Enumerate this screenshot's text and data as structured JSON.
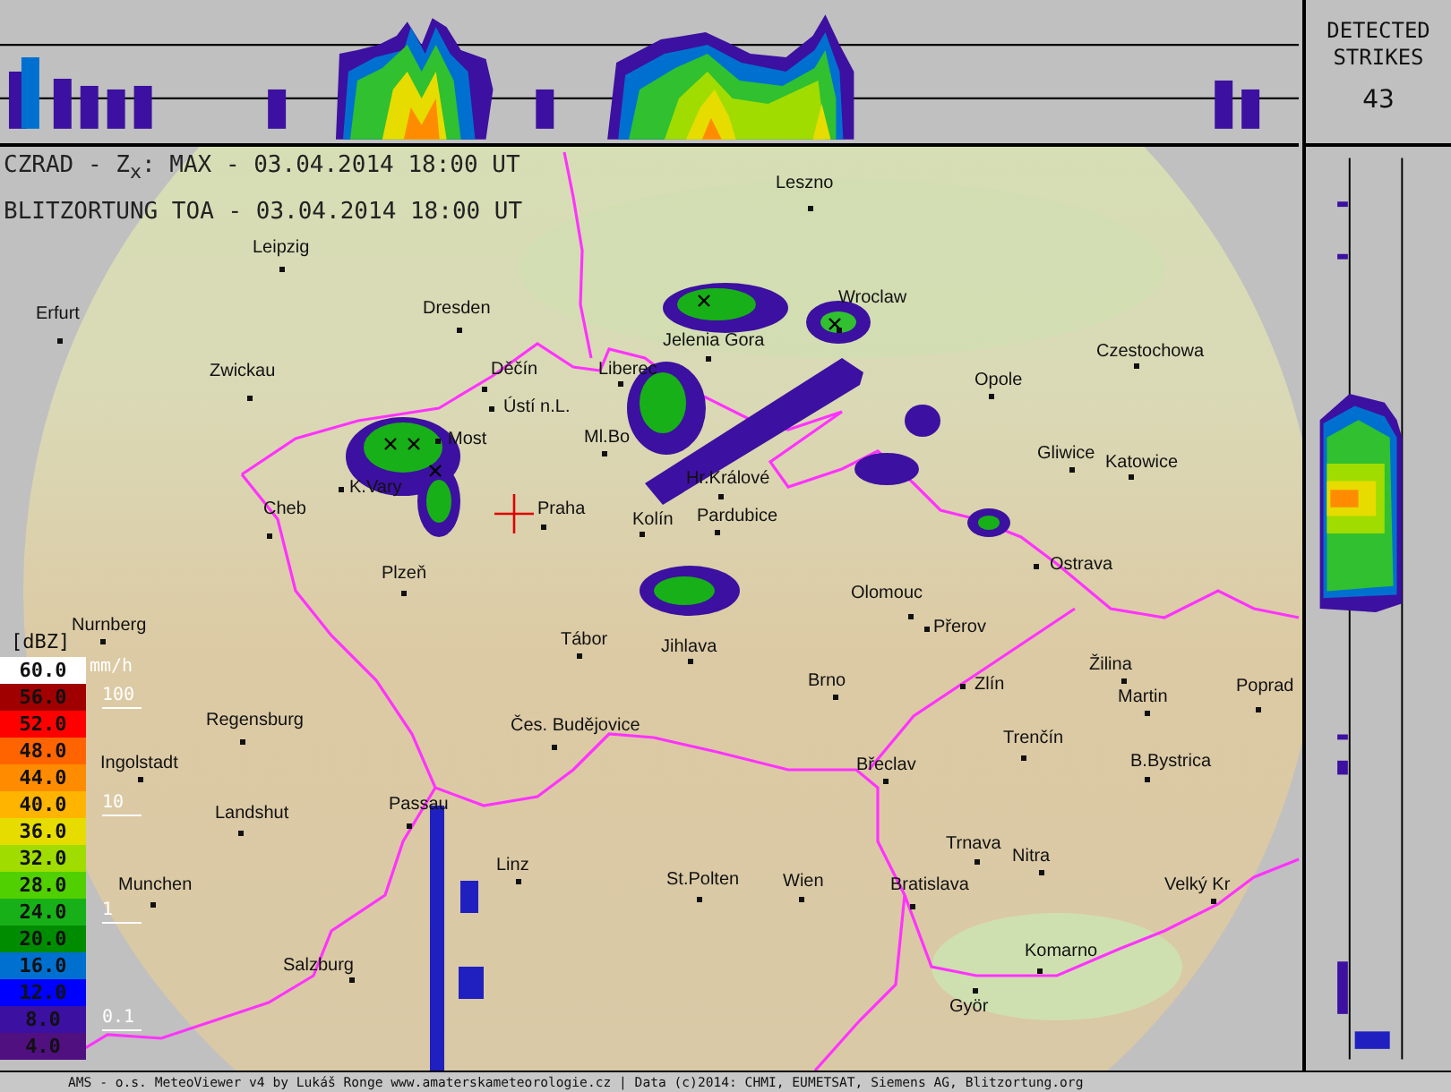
{
  "strikes_panel": {
    "title": "DETECTED STRIKES",
    "count": "43"
  },
  "header": {
    "radar_line": "CZRAD - Z$_{x}$: MAX - 03.04.2014 18:00 UT",
    "lightning_line": "BLITZORTUNG TOA - 03.04.2014 18:00 UT"
  },
  "cities": [
    {
      "name": "Leszno"
    },
    {
      "name": "Leipzig"
    },
    {
      "name": "Dresden"
    },
    {
      "name": "Wroclaw"
    },
    {
      "name": "Jelenia Gora"
    },
    {
      "name": "Liberec"
    },
    {
      "name": "Erfurt"
    },
    {
      "name": "Zwickau"
    },
    {
      "name": "Děčín"
    },
    {
      "name": "Ústí n.L."
    },
    {
      "name": "Most"
    },
    {
      "name": "Ml.Bo"
    },
    {
      "name": "K.Vary"
    },
    {
      "name": "Cheb"
    },
    {
      "name": "Praha"
    },
    {
      "name": "Hr.Králové"
    },
    {
      "name": "Kolín"
    },
    {
      "name": "Pardubice"
    },
    {
      "name": "Czestochowa"
    },
    {
      "name": "Opole"
    },
    {
      "name": "Gliwice"
    },
    {
      "name": "Katowice"
    },
    {
      "name": "Ostrava"
    },
    {
      "name": "Olomouc"
    },
    {
      "name": "Přerov"
    },
    {
      "name": "Plzeň"
    },
    {
      "name": "Tábor"
    },
    {
      "name": "Jihlava"
    },
    {
      "name": "Brno"
    },
    {
      "name": "Zlín"
    },
    {
      "name": "Žilina"
    },
    {
      "name": "Martin"
    },
    {
      "name": "Poprad"
    },
    {
      "name": "Nurnberg"
    },
    {
      "name": "Regensburg"
    },
    {
      "name": "Ingolstadt"
    },
    {
      "name": "Landshut"
    },
    {
      "name": "Passau"
    },
    {
      "name": "Čes. Budějovice"
    },
    {
      "name": "Břeclav"
    },
    {
      "name": "Trenčín"
    },
    {
      "name": "B.Bystrica"
    },
    {
      "name": "Trnava"
    },
    {
      "name": "Nitra"
    },
    {
      "name": "Munchen"
    },
    {
      "name": "Linz"
    },
    {
      "name": "St.Polten"
    },
    {
      "name": "Wien"
    },
    {
      "name": "Bratislava"
    },
    {
      "name": "Velký Kr"
    },
    {
      "name": "Salzburg"
    },
    {
      "name": "Komarno"
    },
    {
      "name": "Györ"
    }
  ],
  "legend": {
    "unit": "[dBZ]",
    "rain_unit": "mm/h",
    "rows": [
      {
        "value": "60.0",
        "color": "#ffffff"
      },
      {
        "value": "56.0",
        "color": "#a00000",
        "rain": "100"
      },
      {
        "value": "52.0",
        "color": "#ff0000"
      },
      {
        "value": "48.0",
        "color": "#ff6400"
      },
      {
        "value": "44.0",
        "color": "#ff8c00"
      },
      {
        "value": "40.0",
        "color": "#ffb400",
        "rain": "10"
      },
      {
        "value": "36.0",
        "color": "#e6dc00"
      },
      {
        "value": "32.0",
        "color": "#a0dc00"
      },
      {
        "value": "28.0",
        "color": "#50d000"
      },
      {
        "value": "24.0",
        "color": "#18b018",
        "rain": "1"
      },
      {
        "value": "20.0",
        "color": "#008c00"
      },
      {
        "value": "16.0",
        "color": "#0070d0"
      },
      {
        "value": "12.0",
        "color": "#0000ff"
      },
      {
        "value": "8.0",
        "color": "#3c10a0",
        "rain": "0.1"
      },
      {
        "value": "4.0",
        "color": "#501080"
      }
    ]
  },
  "footer": "AMS - o.s. MeteoViewer v4 by Lukáš Ronge www.amaterskameteorologie.cz | Data (c)2014: CHMI, EUMETSAT, Siemens AG, Blitzortung.org"
}
